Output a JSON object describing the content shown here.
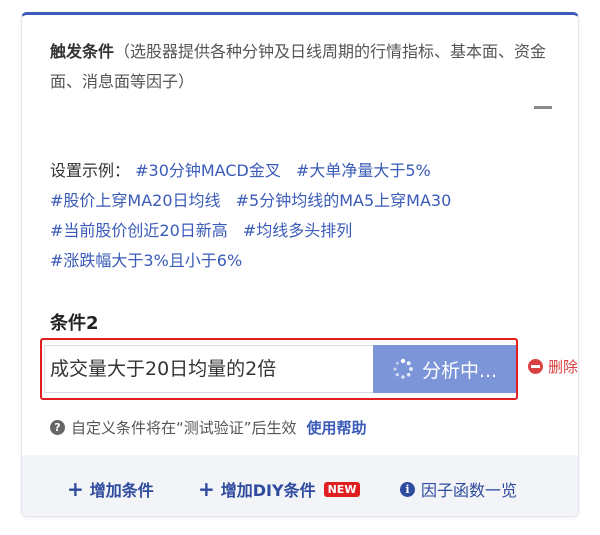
{
  "trigger": {
    "title": "触发条件",
    "description": "（选股器提供各种分钟及日线周期的行情指标、基本面、资金面、消息面等因子）"
  },
  "examples": {
    "label": "设置示例：",
    "tags": [
      "#30分钟MACD金叉",
      "#大单净量大于5%",
      "#股价上穿MA20日均线",
      "#5分钟均线的MA5上穿MA30",
      "#当前股价创近20日新高",
      "#均线多头排列",
      "#涨跌幅大于3%且小于6%"
    ]
  },
  "condition": {
    "title": "条件2",
    "input_value": "成交量大于20日均量的2倍",
    "analyze_label": "分析中...",
    "delete_label": "删除"
  },
  "hint": {
    "text": "自定义条件将在“测试验证”后生效",
    "help_label": "使用帮助"
  },
  "footer": {
    "add_condition": "增加条件",
    "add_diy": "增加DIY条件",
    "new_badge": "NEW",
    "factor_list": "因子函数一览"
  }
}
